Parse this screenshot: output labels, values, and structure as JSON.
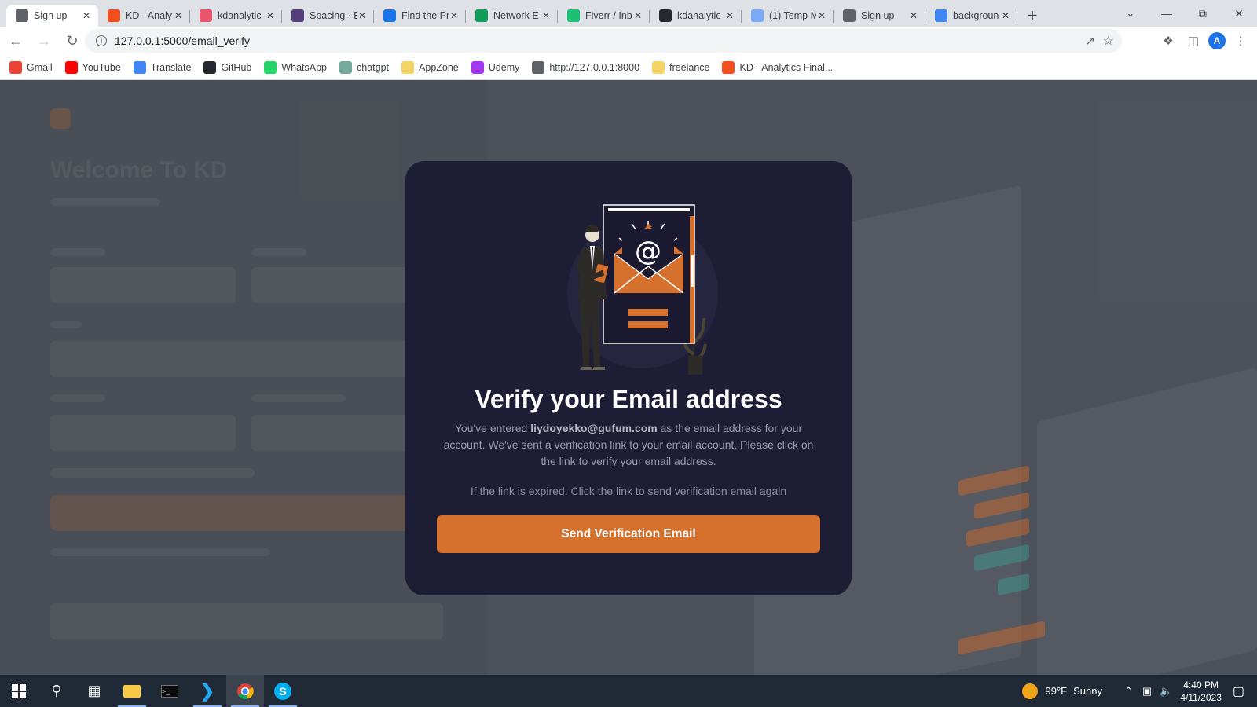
{
  "browser": {
    "tabs": [
      {
        "title": "Sign up",
        "icon": "globe-icon",
        "color": "#5f6368",
        "active": true
      },
      {
        "title": "KD - Analy",
        "icon": "figma-icon",
        "color": "#f24e1e"
      },
      {
        "title": "kdanalytic",
        "icon": "codepen-icon",
        "color": "#e8546b"
      },
      {
        "title": "Spacing · B",
        "icon": "bootstrap-icon",
        "color": "#563d7c"
      },
      {
        "title": "Find the Pr",
        "icon": "flag-icon",
        "color": "#1a73e8"
      },
      {
        "title": "Network E",
        "icon": "sheets-icon",
        "color": "#0f9d58"
      },
      {
        "title": "Fiverr / Inb",
        "icon": "fiverr-icon",
        "color": "#1dbf73"
      },
      {
        "title": "kdanalytic",
        "icon": "github-icon",
        "color": "#24292f"
      },
      {
        "title": "(1) Temp M",
        "icon": "mail-icon",
        "color": "#7baaf7"
      },
      {
        "title": "Sign up",
        "icon": "globe-icon",
        "color": "#5f6368"
      },
      {
        "title": "backgroun",
        "icon": "google-icon",
        "color": "#4285f4"
      }
    ],
    "url": "127.0.0.1:5000/email_verify",
    "avatar_letter": "A",
    "bookmarks": [
      {
        "label": "Gmail",
        "icon": "gmail-icon",
        "color": "#ea4335"
      },
      {
        "label": "YouTube",
        "icon": "youtube-icon",
        "color": "#ff0000"
      },
      {
        "label": "Translate",
        "icon": "translate-icon",
        "color": "#4285f4"
      },
      {
        "label": "GitHub",
        "icon": "github-icon",
        "color": "#24292f"
      },
      {
        "label": "WhatsApp",
        "icon": "whatsapp-icon",
        "color": "#25d366"
      },
      {
        "label": "chatgpt",
        "icon": "chatgpt-icon",
        "color": "#74aa9c"
      },
      {
        "label": "AppZone",
        "icon": "folder-icon",
        "color": "#f6d365"
      },
      {
        "label": "Udemy",
        "icon": "udemy-icon",
        "color": "#a435f0"
      },
      {
        "label": "http://127.0.0.1:8000",
        "icon": "globe-icon",
        "color": "#5f6368"
      },
      {
        "label": "freelance",
        "icon": "folder-icon",
        "color": "#f6d365"
      },
      {
        "label": "KD - Analytics Final...",
        "icon": "figma-icon",
        "color": "#f24e1e"
      }
    ]
  },
  "background_page": {
    "heading": "Welcome To KD"
  },
  "modal": {
    "title": "Verify your Email address",
    "body_prefix": "You've entered ",
    "email": "liydoyekko@gufum.com",
    "body_suffix": " as the email address for your account. We've sent a verification link to your email account. Please click on the link to verify your email address.",
    "note": "If the link is expired. Click the link to send verification email again",
    "button_label": "Send Verification Email",
    "accent": "#d5702d",
    "background": "#1e1d36"
  },
  "taskbar": {
    "weather_temp": "99°F",
    "weather_text": "Sunny",
    "time": "4:40 PM",
    "date": "4/11/2023"
  }
}
